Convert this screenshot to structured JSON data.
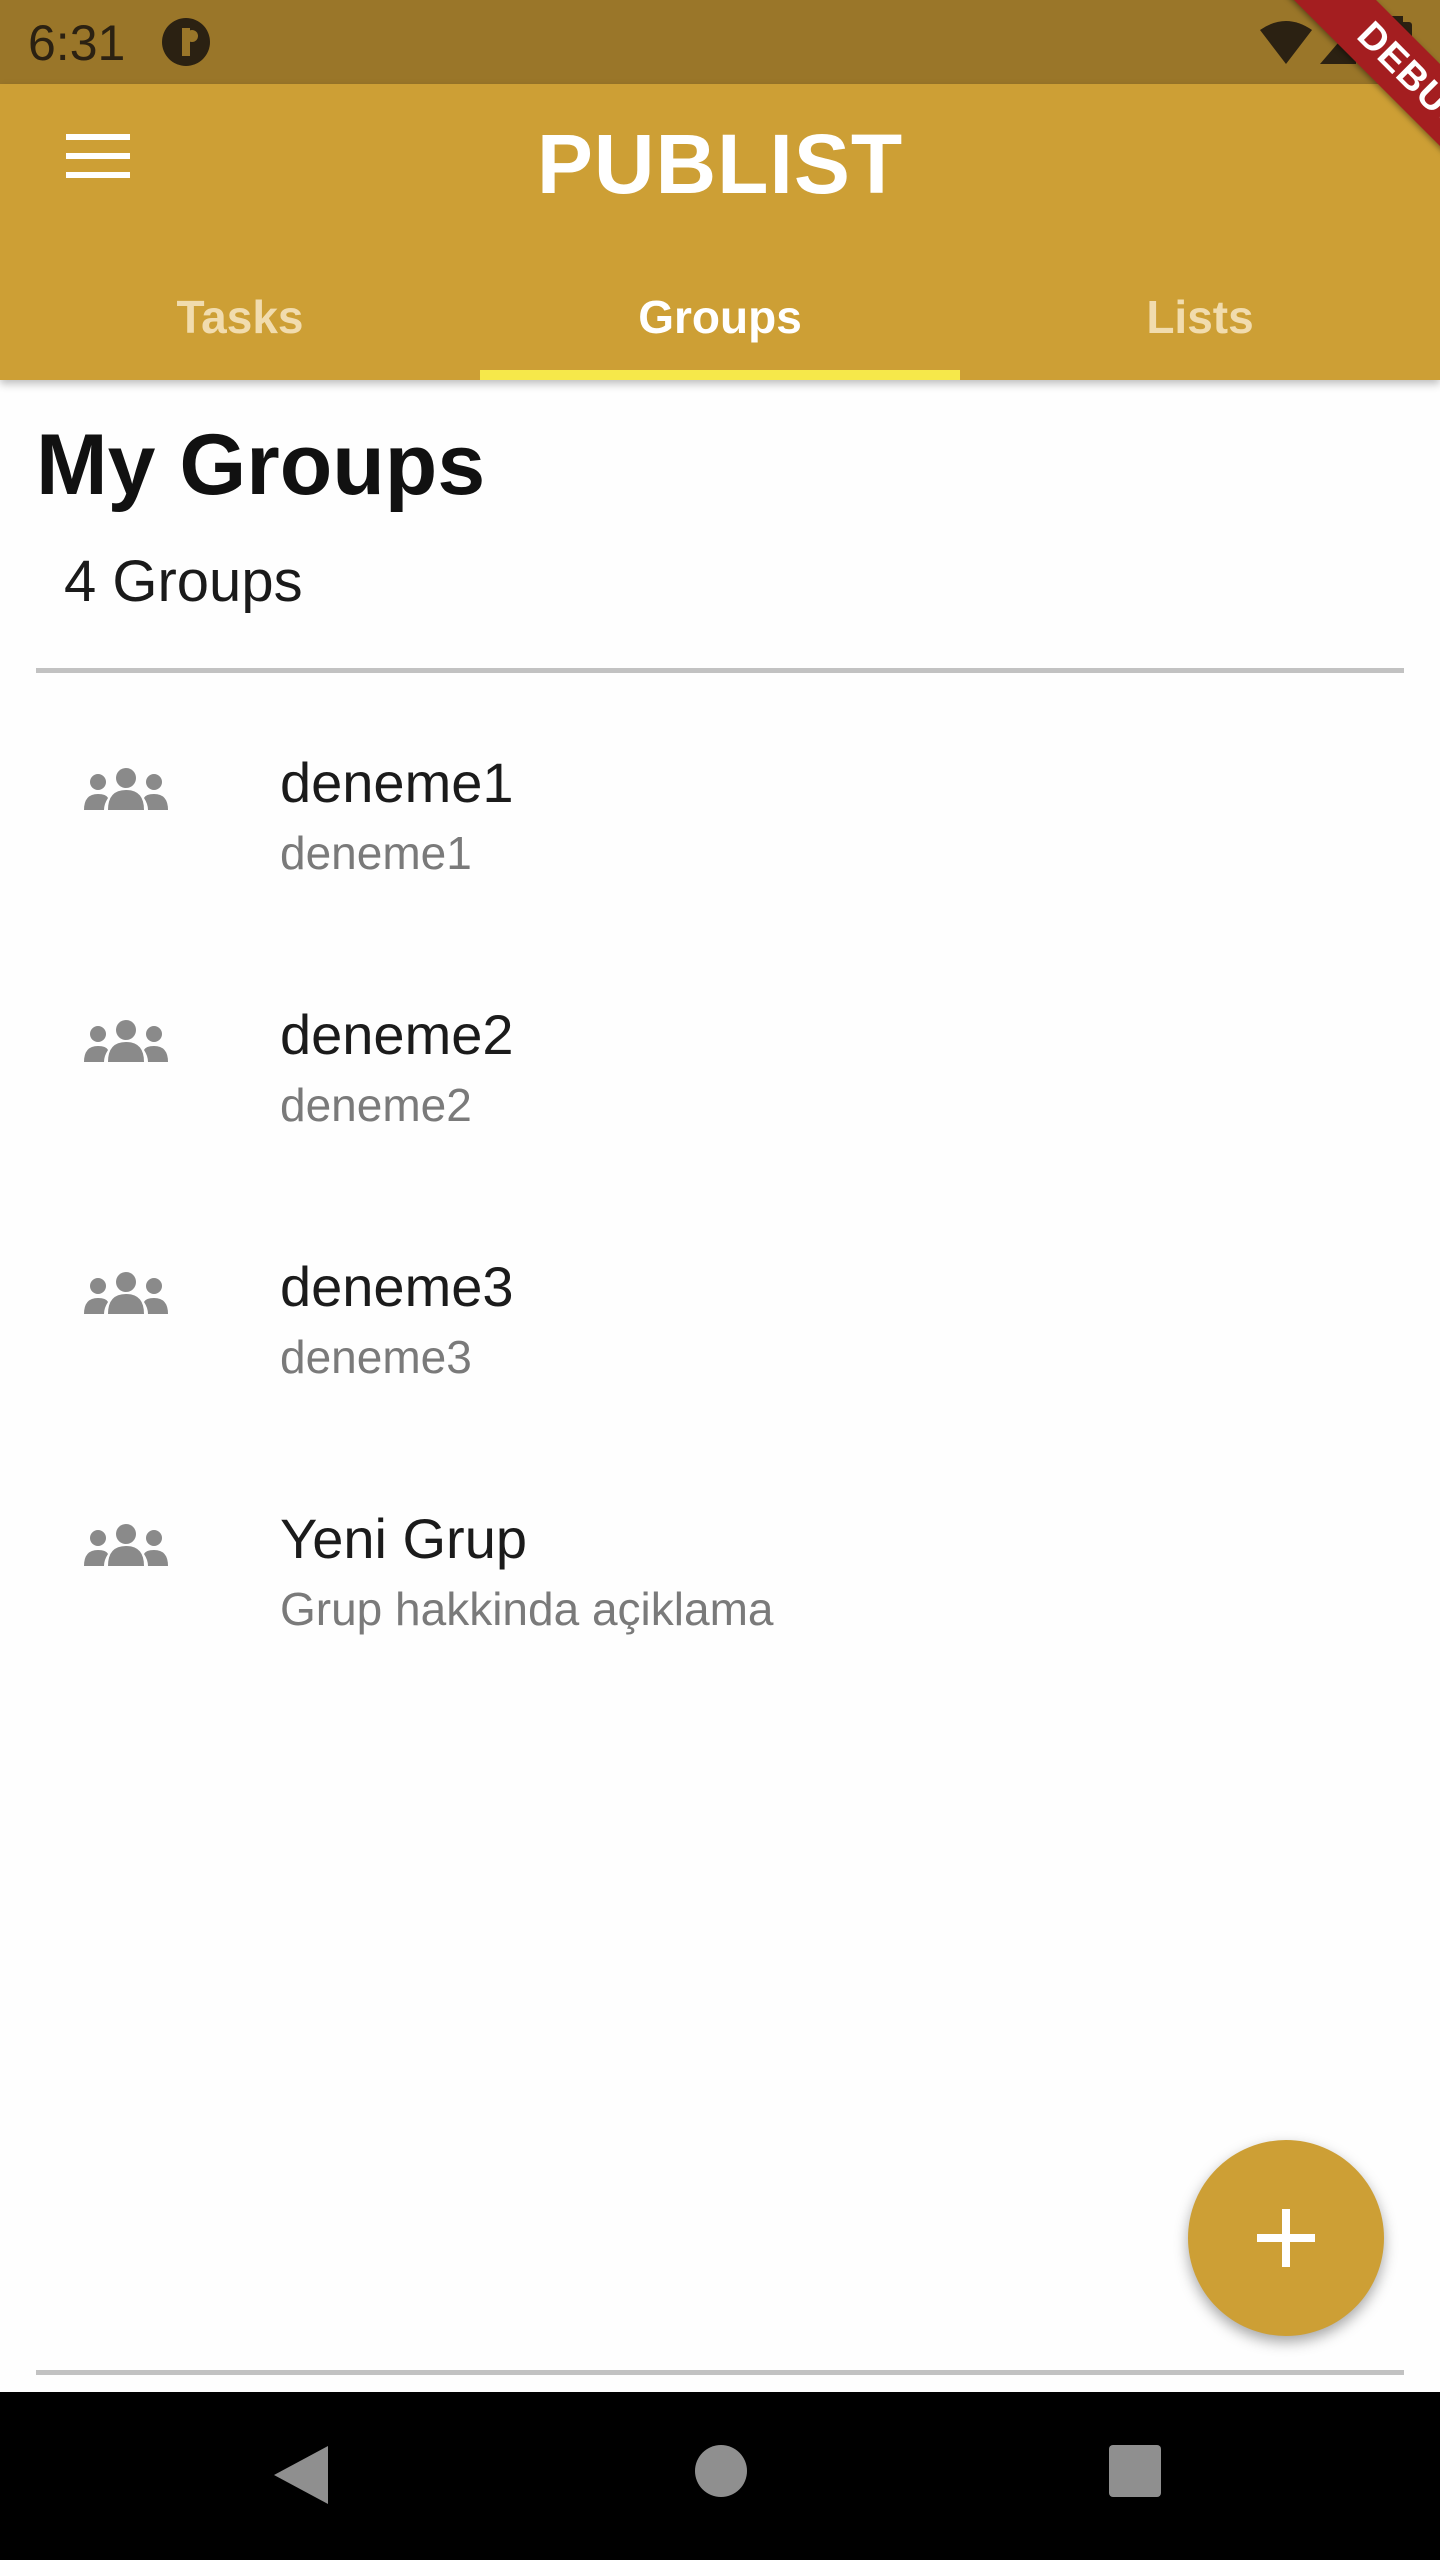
{
  "status_bar": {
    "time": "6:31"
  },
  "debug_banner": "DEBUG",
  "app_bar": {
    "title": "PUBLIST"
  },
  "tabs": [
    {
      "label": "Tasks",
      "active": false
    },
    {
      "label": "Groups",
      "active": true
    },
    {
      "label": "Lists",
      "active": false
    }
  ],
  "main": {
    "title": "My Groups",
    "count_label": "4 Groups",
    "groups": [
      {
        "name": "deneme1",
        "description": "deneme1",
        "icon": "groups-icon"
      },
      {
        "name": "deneme2",
        "description": "deneme2",
        "icon": "groups-icon"
      },
      {
        "name": "deneme3",
        "description": "deneme3",
        "icon": "groups-icon"
      },
      {
        "name": "Yeni Grup",
        "description": "Grup hakkinda açiklama",
        "icon": "groups-icon"
      }
    ]
  },
  "fab": {
    "icon": "plus-icon"
  },
  "colors": {
    "primary": "#cd9f35",
    "status_bar": "#9a7629",
    "tab_indicator": "#f6e84a",
    "debug_ribbon": "#a41e20"
  }
}
